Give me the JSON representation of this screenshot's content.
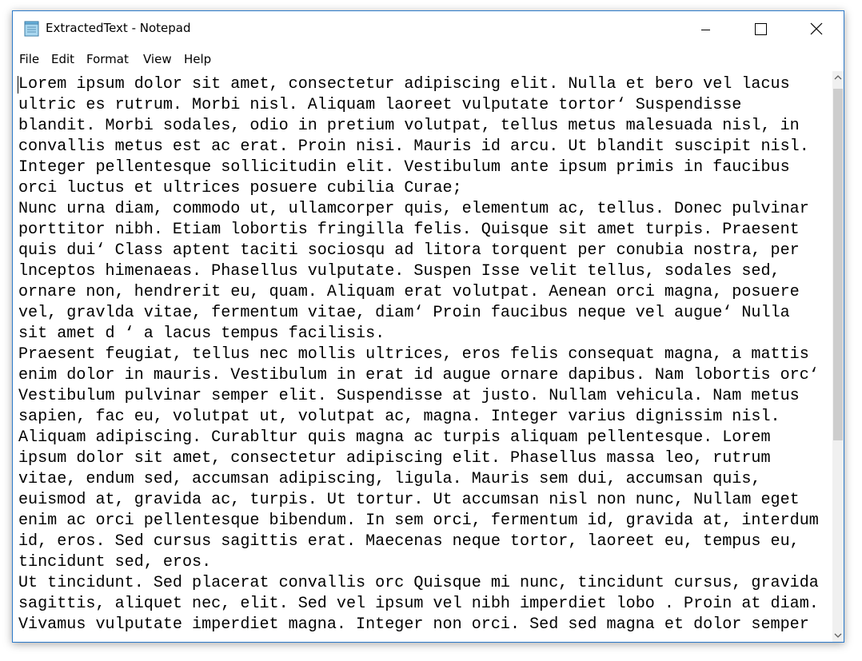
{
  "window": {
    "title": "ExtractedText - Notepad"
  },
  "menu": {
    "items": [
      {
        "label": "File"
      },
      {
        "label": "Edit"
      },
      {
        "label": "Format"
      },
      {
        "label": "View"
      },
      {
        "label": "Help"
      }
    ]
  },
  "editor": {
    "content": "Lorem ipsum dolor sit amet, consectetur adipiscing elit. Nulla et bero vel lacus\nultric es rutrum. Morbi nisl. Aliquam laoreet vulputate tortor‘ Suspendisse\nblandit. Morbi sodales, odio in pretium volutpat, tellus metus malesuada nisl, in\nconvallis metus est ac erat. Proin nisi. Mauris id arcu. Ut blandit suscipit nisl.\nInteger pellentesque sollicitudin elit. Vestibulum ante ipsum primis in faucibus\norci luctus et ultrices posuere cubilia Curae;\nNunc urna diam, commodo ut, ullamcorper quis, elementum ac, tellus. Donec pulvinar\nporttitor nibh. Etiam lobortis fringilla felis. Quisque sit amet turpis. Praesent\nquis dui‘ Class aptent taciti sociosqu ad litora torquent per conubia nostra, per\nlnceptos himenaeas. Phasellus vulputate. Suspen Isse velit tellus, sodales sed,\nornare non, hendrerit eu, quam. Aliquam erat volutpat. Aenean orci magna, posuere\nvel, gravlda vitae, fermentum vitae, diam‘ Proin faucibus neque vel augue‘ Nulla\nsit amet d ‘ a lacus tempus facilisis.\nPraesent feugiat, tellus nec mollis ultrices, eros felis consequat magna, a mattis\nenim dolor in mauris. Vestibulum in erat id augue ornare dapibus. Nam lobortis orc‘\nVestibulum pulvinar semper elit. Suspendisse at justo. Nullam vehicula. Nam metus\nsapien, fac eu, volutpat ut, volutpat ac, magna. Integer varius dignissim nisl.\nAliquam adipiscing. Curabltur quis magna ac turpis aliquam pellentesque. Lorem\nipsum dolor sit amet, consectetur adipiscing elit. Phasellus massa leo, rutrum\nvitae, endum sed, accumsan adipiscing, ligula. Mauris sem dui, accumsan quis,\neuismod at, gravida ac, turpis. Ut tortur. Ut accumsan nisl non nunc, Nullam eget\nenim ac orci pellentesque bibendum. In sem orci, fermentum id, gravida at, interdum\nid, eros. Sed cursus sagittis erat. Maecenas neque tortor, laoreet eu, tempus eu,\ntincidunt sed, eros.\nUt tincidunt. Sed placerat convallis orc Quisque mi nunc, tincidunt cursus, gravida\nsagittis, aliquet nec, elit. Sed vel ipsum vel nibh imperdiet lobo . Proin at diam.\nVivamus vulputate imperdiet magna. Integer non orci. Sed sed magna et dolor semper"
  },
  "icons": {
    "app": "notepad-icon",
    "minimize": "minimize-icon",
    "maximize": "maximize-icon",
    "close": "close-icon",
    "scroll_up": "chevron-up-icon",
    "scroll_down": "chevron-down-icon"
  },
  "colors": {
    "window_border": "#2b79c9",
    "scroll_track": "#f0f0f0",
    "scroll_thumb": "#cdcdcd"
  }
}
